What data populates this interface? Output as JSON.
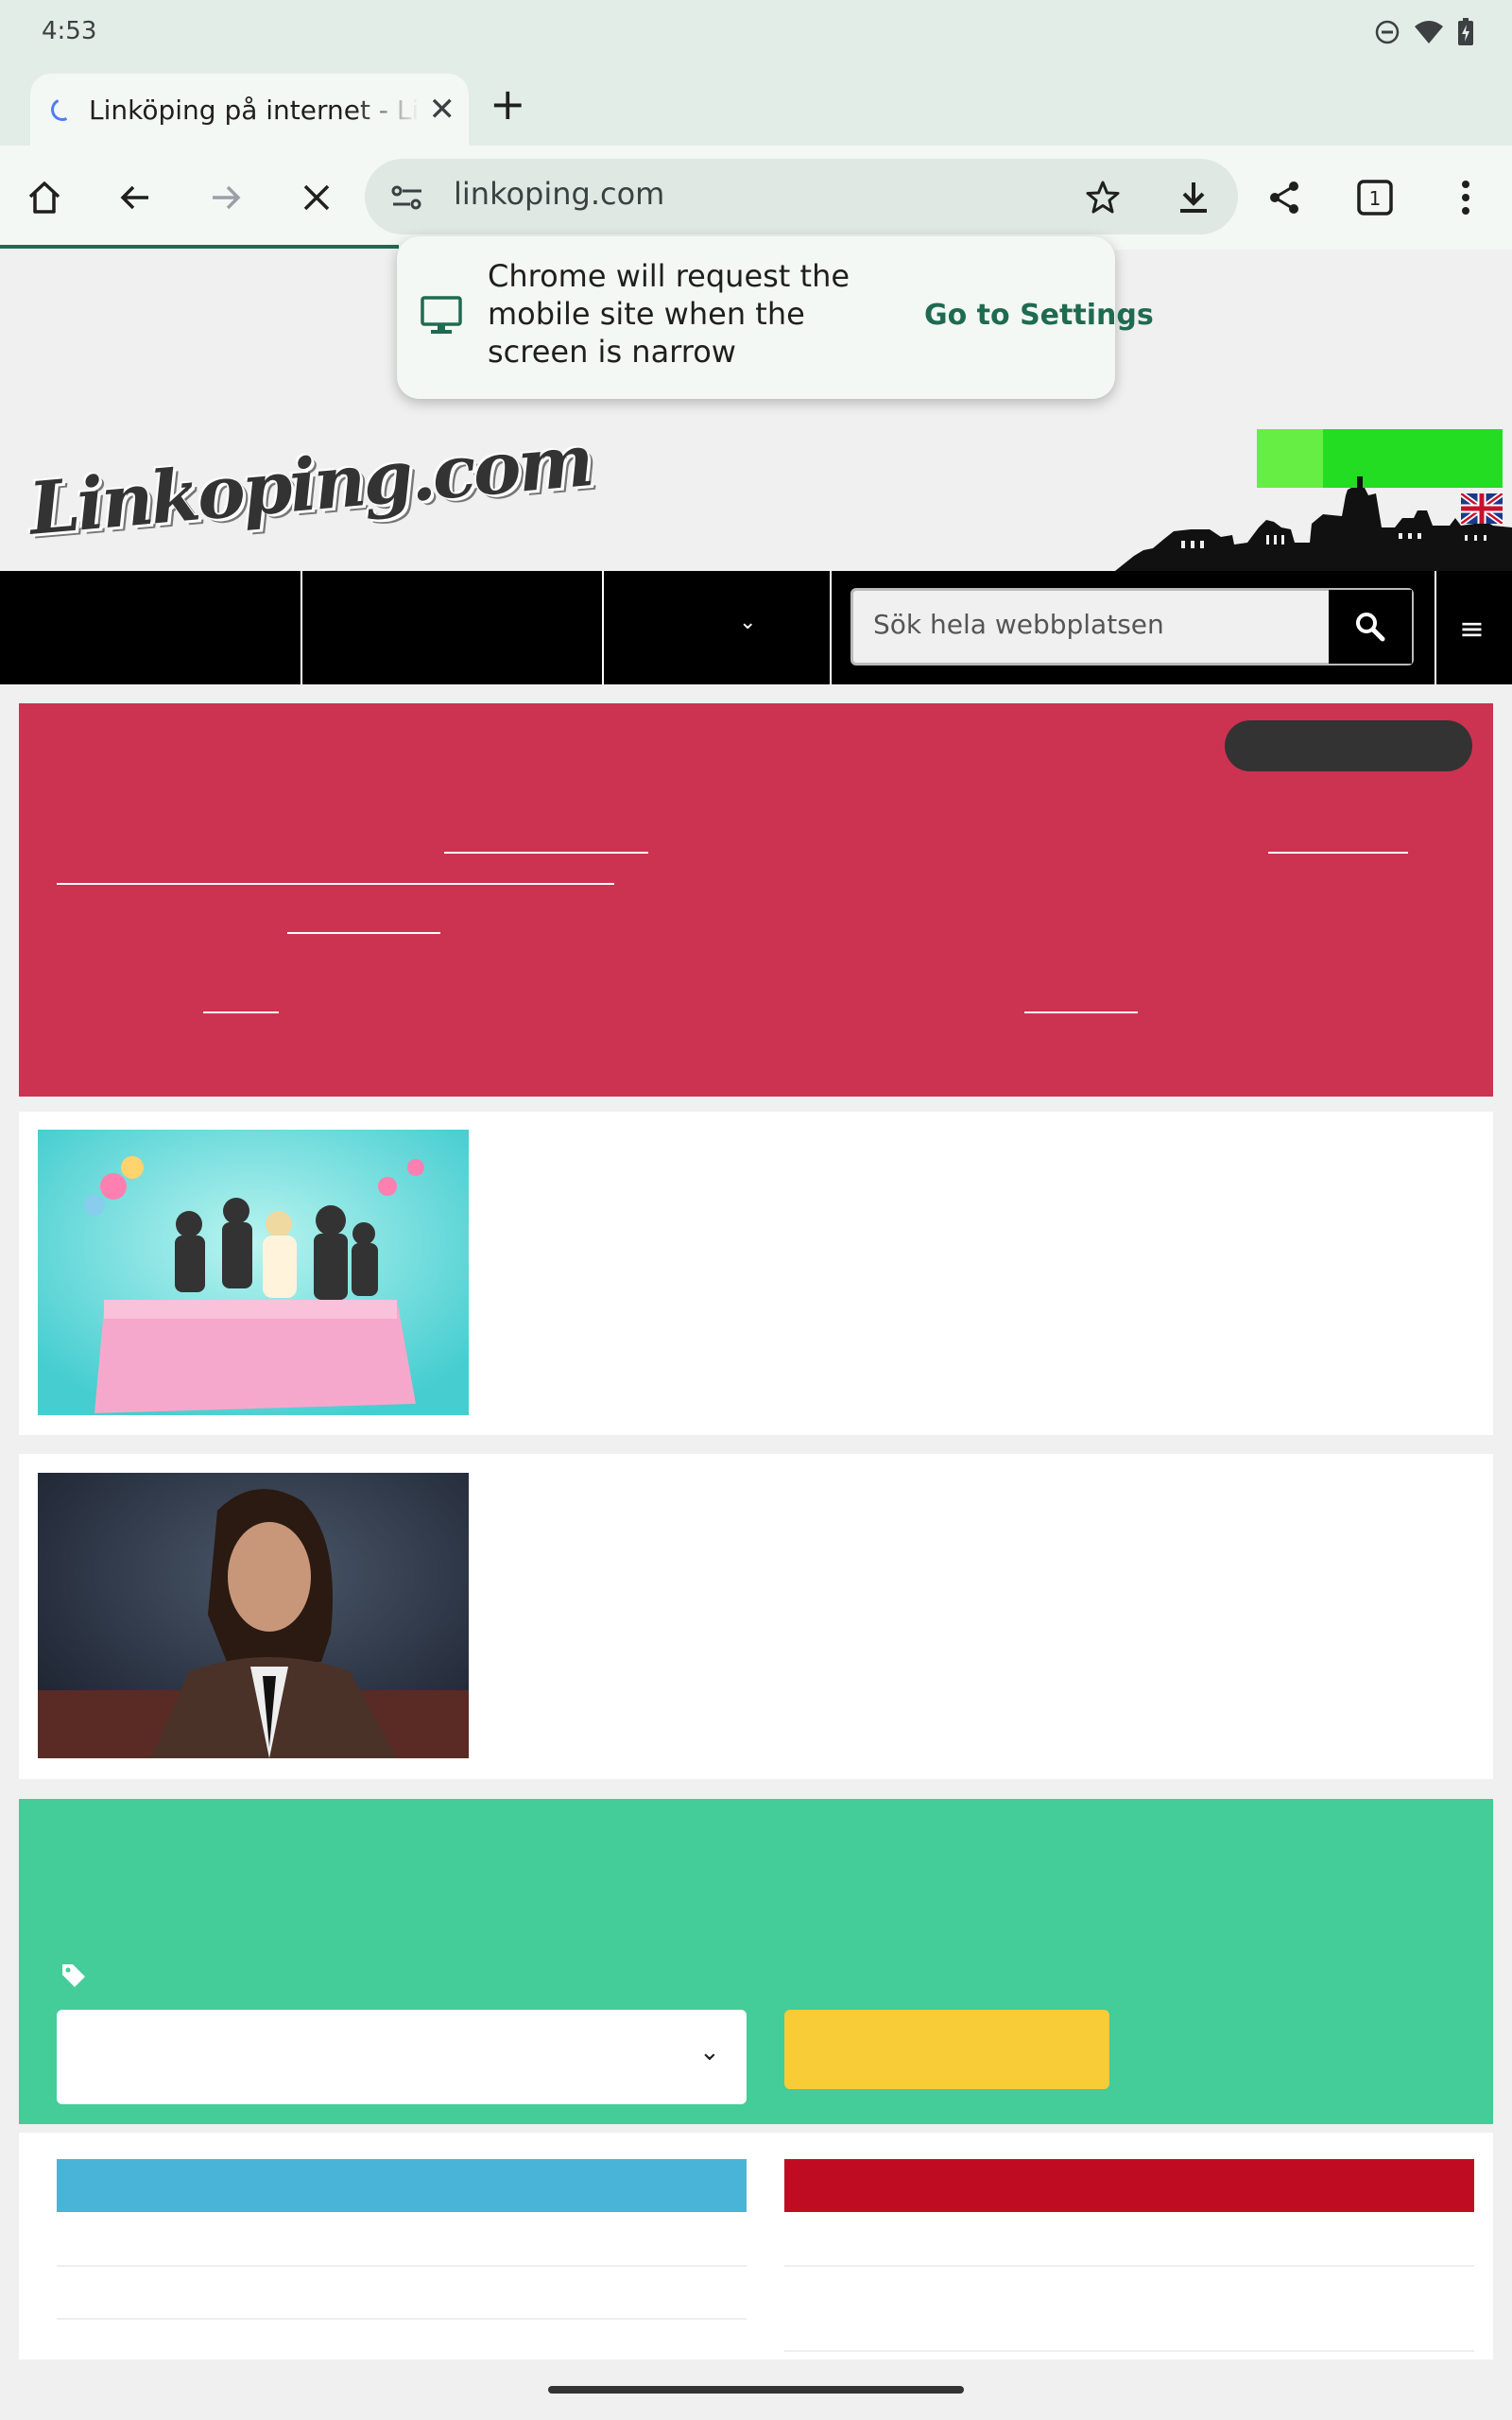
{
  "status_bar": {
    "time": "4:53"
  },
  "tab": {
    "title": "Linköping på internet - Linköping"
  },
  "toolbar": {
    "url": "linkoping.com",
    "tab_count": "1"
  },
  "popup": {
    "message": "Chrome will request the mobile site when the screen is narrow",
    "action_label": "Go to Settings"
  },
  "site": {
    "logo_text": "Linkoping.com",
    "search_placeholder": "Sök hela webbplatsen"
  },
  "colors": {
    "red_banner": "#cc3351",
    "green_block": "#44cc99",
    "yellow_button": "#f8cc36",
    "blue_bar": "#4ab4d8",
    "dark_red_bar": "#c00c22",
    "accent_green": "#1e6b52"
  }
}
